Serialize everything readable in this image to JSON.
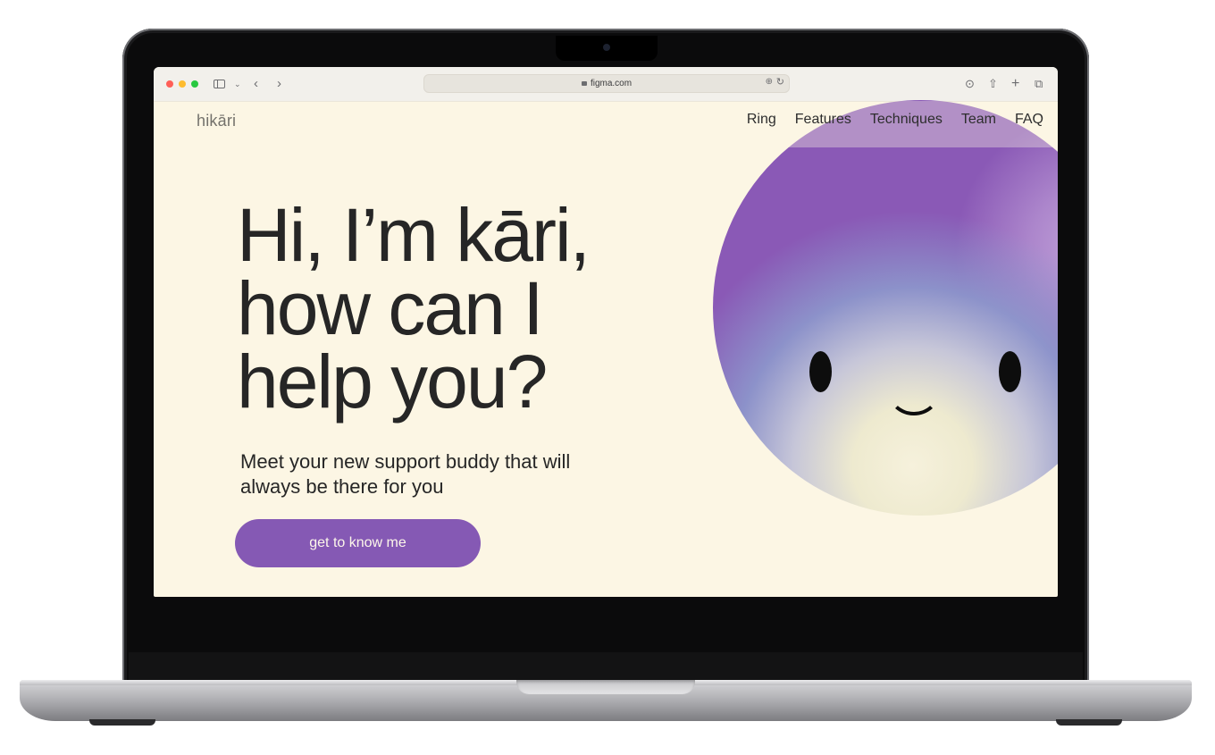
{
  "browser": {
    "url": "figma.com",
    "icons": [
      "sidebar-icon",
      "chevron-down-icon",
      "back-icon",
      "forward-icon",
      "lock-icon",
      "translate-icon",
      "reload-icon",
      "download-icon",
      "share-icon",
      "new-tab-icon",
      "tabs-overview-icon"
    ]
  },
  "site": {
    "logo": "hikāri",
    "nav": [
      "Ring",
      "Features",
      "Techniques",
      "Team",
      "FAQ"
    ],
    "hero": {
      "title": "Hi, I’m kāri,\nhow can I\nhelp you?",
      "subtitle": "Meet your new support buddy that will always be there for you",
      "cta": "get to know me"
    },
    "colors": {
      "background": "#fcf6e4",
      "accent": "#8559b4",
      "text": "#262626"
    }
  }
}
